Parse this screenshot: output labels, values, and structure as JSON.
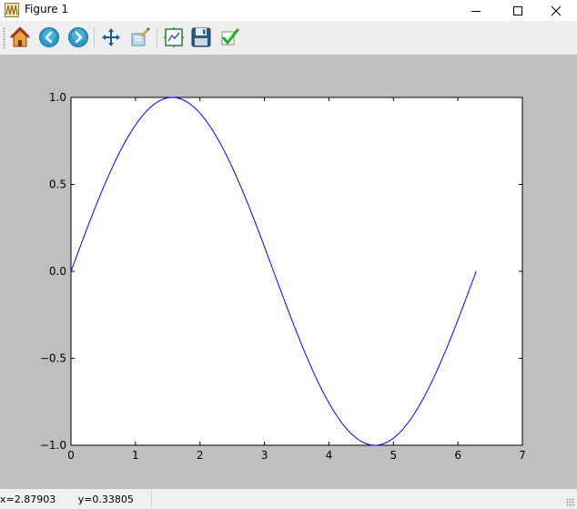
{
  "window": {
    "title": "Figure 1",
    "controls": [
      "minimize",
      "maximize",
      "close"
    ]
  },
  "toolbar": {
    "buttons": [
      {
        "name": "home",
        "icon": "home-icon"
      },
      {
        "name": "back",
        "icon": "back-arrow-icon"
      },
      {
        "name": "forward",
        "icon": "forward-arrow-icon"
      },
      {
        "name": "pan",
        "icon": "pan-move-icon"
      },
      {
        "name": "zoom",
        "icon": "zoom-rect-icon"
      },
      {
        "name": "subplots",
        "icon": "configure-subplots-icon"
      },
      {
        "name": "save",
        "icon": "floppy-disk-icon"
      },
      {
        "name": "edit",
        "icon": "checkmark-icon"
      }
    ]
  },
  "status": {
    "coords": "x=2.87903       y=0.33805"
  },
  "chart_data": {
    "type": "line",
    "title": "",
    "xlabel": "",
    "ylabel": "",
    "xlim": [
      0,
      7
    ],
    "ylim": [
      -1.0,
      1.0
    ],
    "xticks": [
      "0",
      "1",
      "2",
      "3",
      "4",
      "5",
      "6",
      "7"
    ],
    "yticks": [
      "1.0",
      "0.5",
      "0.0",
      "−0.5",
      "−1.0"
    ],
    "grid": false,
    "series": [
      {
        "color": "#0000ff",
        "x_range": [
          0,
          6.2832
        ],
        "x": [
          0,
          0.3307,
          0.6614,
          0.9921,
          1.3228,
          1.5708,
          1.9842,
          2.3149,
          2.6456,
          2.9762,
          3.3069,
          3.6376,
          3.9683,
          4.299,
          4.7124,
          4.9604,
          5.2911,
          5.6218,
          5.9525,
          6.2832
        ],
        "y": [
          0,
          0.3247,
          0.6142,
          0.8372,
          0.9697,
          1.0,
          0.9158,
          0.7357,
          0.4759,
          0.1646,
          -0.1646,
          -0.4759,
          -0.7357,
          -0.9158,
          -1.0,
          -0.9697,
          -0.8372,
          -0.6142,
          -0.3247,
          0
        ]
      }
    ]
  }
}
